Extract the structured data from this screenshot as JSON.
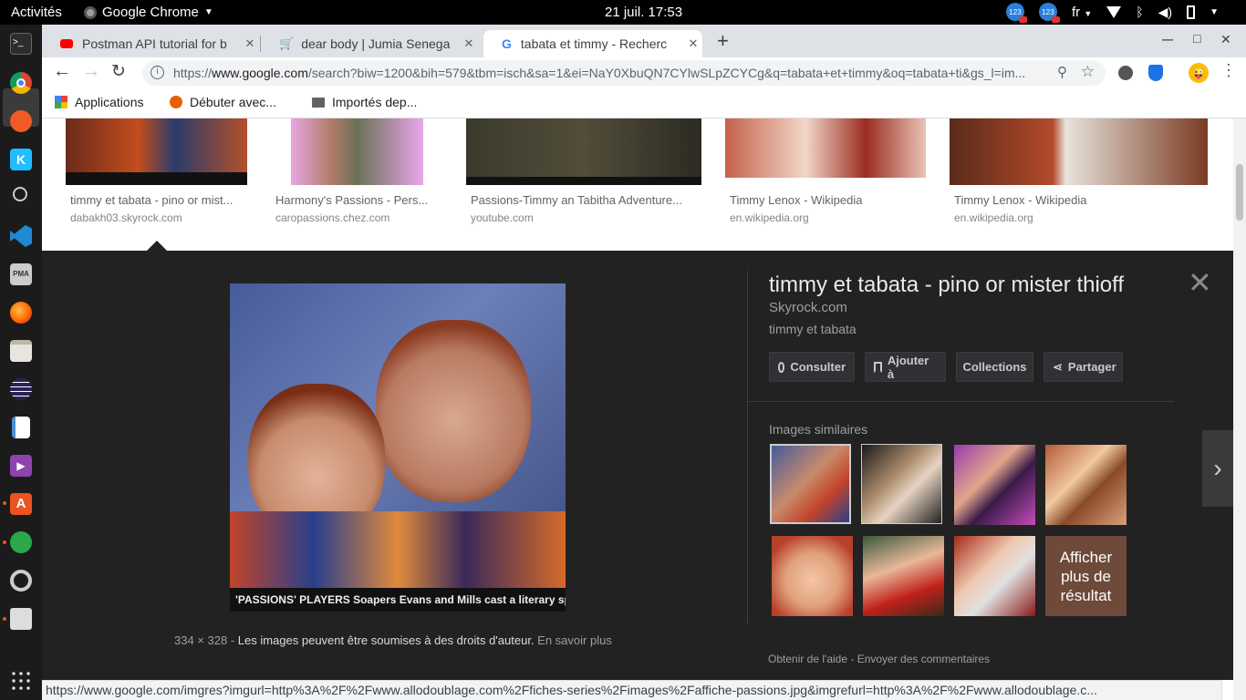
{
  "system": {
    "activities": "Activités",
    "app_name": "Google Chrome",
    "clock": "21 juil.  17:53",
    "badge": "123",
    "lang": "fr"
  },
  "tabs": [
    {
      "title": "Postman API tutorial for b"
    },
    {
      "title": "dear body | Jumia Senega"
    },
    {
      "title": "tabata et timmy - Recherc"
    }
  ],
  "tab_close": "✕",
  "new_tab": "+",
  "window": {
    "minimize": "—",
    "maximize": "□",
    "close": "✕"
  },
  "address": {
    "scheme": "https://",
    "domain": "www.google.com",
    "path": "/search?biw=1200&bih=579&tbm=isch&sa=1&ei=NaY0XbuQN7CYlwSLpZCYCg&q=tabata+et+timmy&oq=tabata+ti&gs_l=im..."
  },
  "bookmarks": [
    {
      "label": "Applications"
    },
    {
      "label": "Débuter avec..."
    },
    {
      "label": "Importés dep..."
    }
  ],
  "results": [
    {
      "title": "timmy et tabata - pino or mist...",
      "site": "dabakh03.skyrock.com"
    },
    {
      "title": "Harmony's Passions - Pers...",
      "site": "caropassions.chez.com"
    },
    {
      "title": "Passions-Timmy an Tabitha Adventure...",
      "site": "youtube.com"
    },
    {
      "title": "Timmy Lenox - Wikipedia",
      "site": "en.wikipedia.org"
    },
    {
      "title": "Timmy Lenox - Wikipedia",
      "site": "en.wikipedia.org"
    }
  ],
  "panel": {
    "title": "timmy et tabata - pino or mister thioff",
    "site": "Skyrock.com",
    "desc": "timmy et tabata",
    "caption": "'PASSIONS' PLAYERS Soapers Evans and Mills cast a literary spell",
    "buttons": {
      "visit": "Consulter",
      "add": "Ajouter à",
      "collections": "Collections",
      "share": "Partager"
    },
    "similar_label": "Images similaires",
    "more": "Afficher plus de résultat",
    "dims": "334 × 328",
    "dims_sep": " - ",
    "copyright": "Les images peuvent être soumises à des droits d'auteur.",
    "learn_more": "En savoir plus",
    "help": "Obtenir de l'aide",
    "feedback": "Envoyer des commentaires",
    "foot_sep": " - ",
    "close": "✕",
    "next": "›"
  },
  "status_url": "https://www.google.com/imgres?imgurl=http%3A%2F%2Fwww.allodoublage.com%2Ffiches-series%2Fimages%2Faffiche-passions.jpg&imgrefurl=http%3A%2F%2Fwww.allodoublage.c...",
  "colors": {
    "panel_bg": "#222222",
    "chrome_tabs": "#dee1e6",
    "accent_blue": "#1a73e8",
    "ubuntu_orange": "#e95420"
  }
}
